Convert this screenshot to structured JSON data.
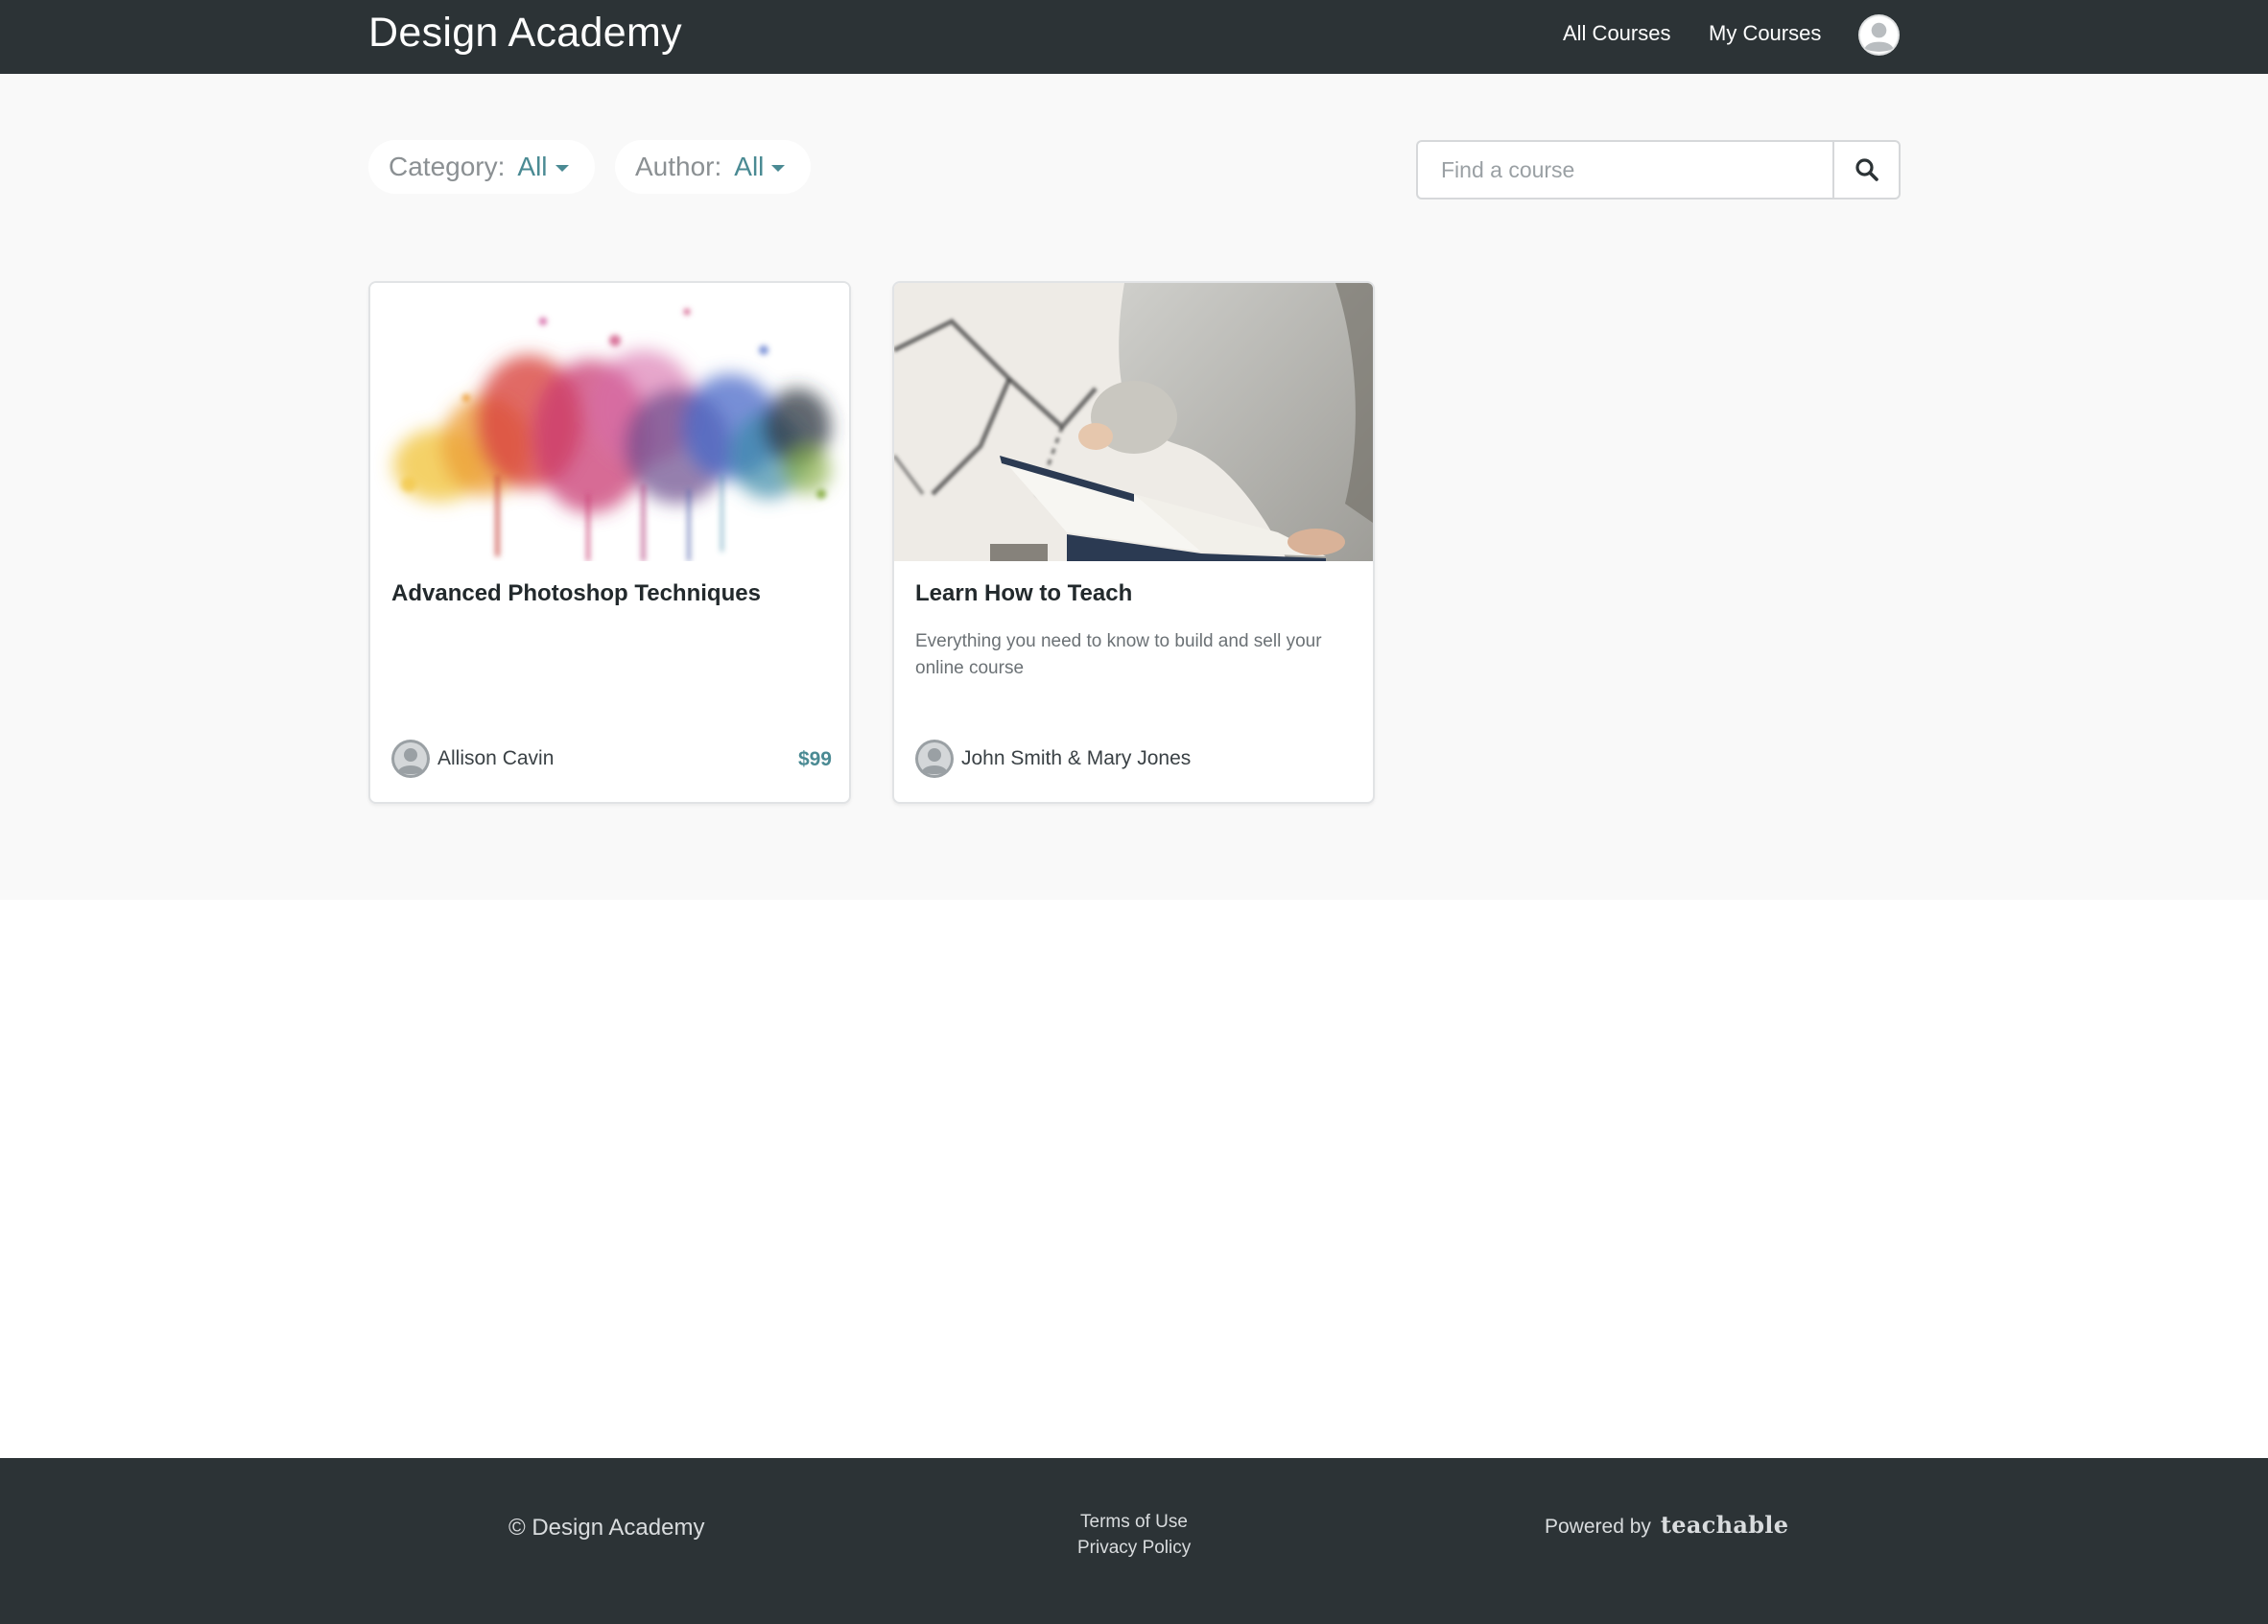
{
  "navbar": {
    "brand": "Design Academy",
    "links": [
      {
        "label": "All Courses"
      },
      {
        "label": "My Courses"
      }
    ]
  },
  "filters": {
    "category": {
      "label": "Category:",
      "value": "All"
    },
    "author": {
      "label": "Author:",
      "value": "All"
    }
  },
  "search": {
    "placeholder": "Find a course",
    "value": ""
  },
  "courses": [
    {
      "title": "Advanced Photoshop Techniques",
      "description": "",
      "author": "Allison Cavin",
      "price": "$99"
    },
    {
      "title": "Learn How to Teach",
      "description": "Everything you need to know to build and sell your online course",
      "author": "John Smith & Mary Jones",
      "price": ""
    }
  ],
  "footer": {
    "copyright": "© Design Academy",
    "links": [
      {
        "label": "Terms of Use"
      },
      {
        "label": "Privacy Policy"
      }
    ],
    "powered_by": "Powered by",
    "powered_brand": "teachable"
  },
  "colors": {
    "navbar_bg": "#2c3336",
    "accent": "#4a8a93",
    "page_bg": "#f9f9f9"
  }
}
